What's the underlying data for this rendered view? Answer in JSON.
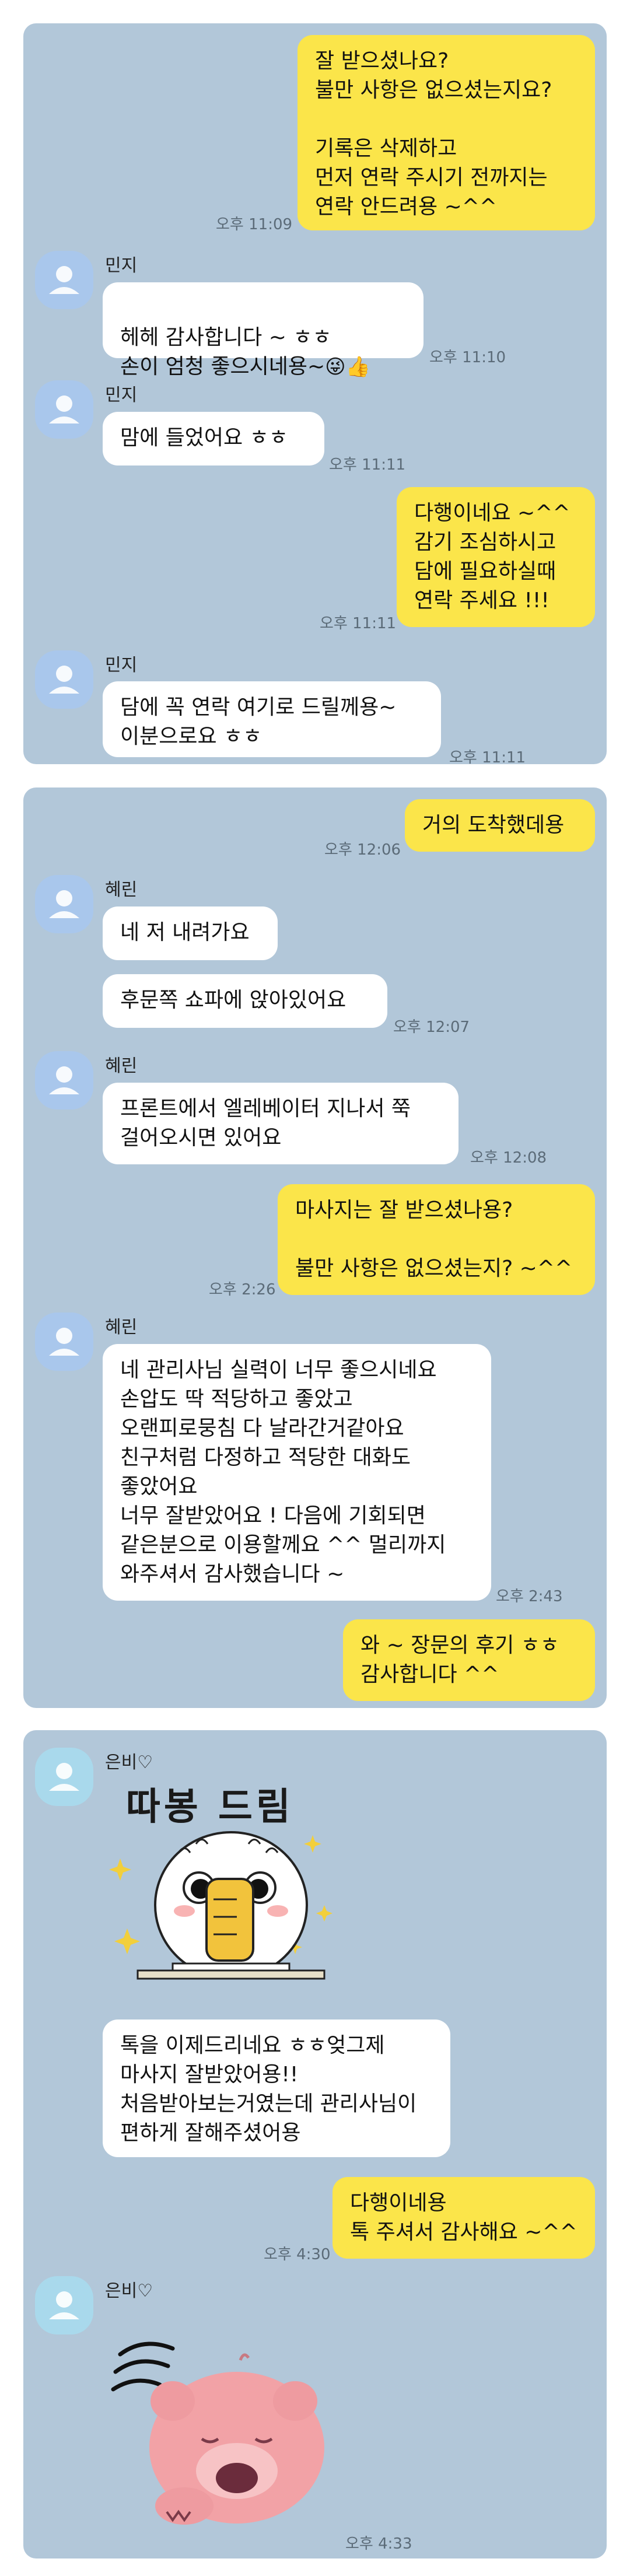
{
  "panel1": {
    "m1": {
      "text": "잘 받으셨나요?\n불만 사항은 없으셨는지요?\n\n기록은 삭제하고\n먼저 연락 주시기 전까지는\n연락 안드려용 ~^^",
      "time": "오후 11:09"
    },
    "name1": "민지",
    "t1": {
      "text": "헤헤 감사합니다 ~ ㅎㅎ\n손이 엄청 좋으시네용~",
      "time": "오후 11:10",
      "emoji": "😜👍"
    },
    "name2": "민지",
    "t2": {
      "text": "맘에 들었어요 ㅎㅎ",
      "time": "오후 11:11"
    },
    "m2": {
      "text": "다행이네요 ~^^\n감기 조심하시고\n담에 필요하실때\n연락 주세요 !!!",
      "time": "오후 11:11"
    },
    "name3": "민지",
    "t3": {
      "text": "담에 꼭 연락 여기로 드릴께용~\n이분으로요 ㅎㅎ",
      "time": "오후 11:11"
    }
  },
  "panel2": {
    "m1": {
      "text": "거의 도착했데용",
      "time": "오후 12:06"
    },
    "name1": "혜린",
    "t1": {
      "text": "네 저 내려가요"
    },
    "t2": {
      "text": "후문쪽 쇼파에 앉아있어요",
      "time": "오후 12:07"
    },
    "name2": "혜린",
    "t3": {
      "text": "프론트에서 엘레베이터 지나서 쭉\n걸어오시면 있어요",
      "time": "오후 12:08"
    },
    "m2": {
      "text": "마사지는 잘 받으셨나용?\n\n불만 사항은 없으셨는지? ~^^",
      "time": "오후 2:26"
    },
    "name3": "혜린",
    "t4": {
      "text": "네 관리사님 실력이 너무 좋으시네요\n손압도 딱 적당하고 좋았고\n오랜피로뭉침 다 날라간거같아요\n친구처럼 다정하고 적당한 대화도\n좋았어요\n너무 잘받았어요 ! 다음에 기회되면\n같은분으로 이용할께요 ^^ 멀리까지\n와주셔서 감사했습니다 ~",
      "time": "오후 2:43"
    },
    "m3": {
      "text": "와 ~ 장문의 후기 ㅎㅎ\n감사합니다 ^^"
    }
  },
  "panel3": {
    "name1": "은비♡",
    "sticker1_title": "따봉 드림",
    "t1": {
      "text": "톡을 이제드리네요 ㅎㅎ엊그제\n마사지 잘받았어용!!\n처음받아보는거였는데 관리사님이\n편하게 잘해주셨어용"
    },
    "m1": {
      "text": "다행이네용\n톡 주셔서 감사해요 ~^^",
      "time": "오후 4:30"
    },
    "name2": "은비♡",
    "time_last": "오후 4:33"
  },
  "colors": {
    "background": "#b2c7d9",
    "my_bubble": "#fbe54a",
    "their_bubble": "#ffffff"
  }
}
